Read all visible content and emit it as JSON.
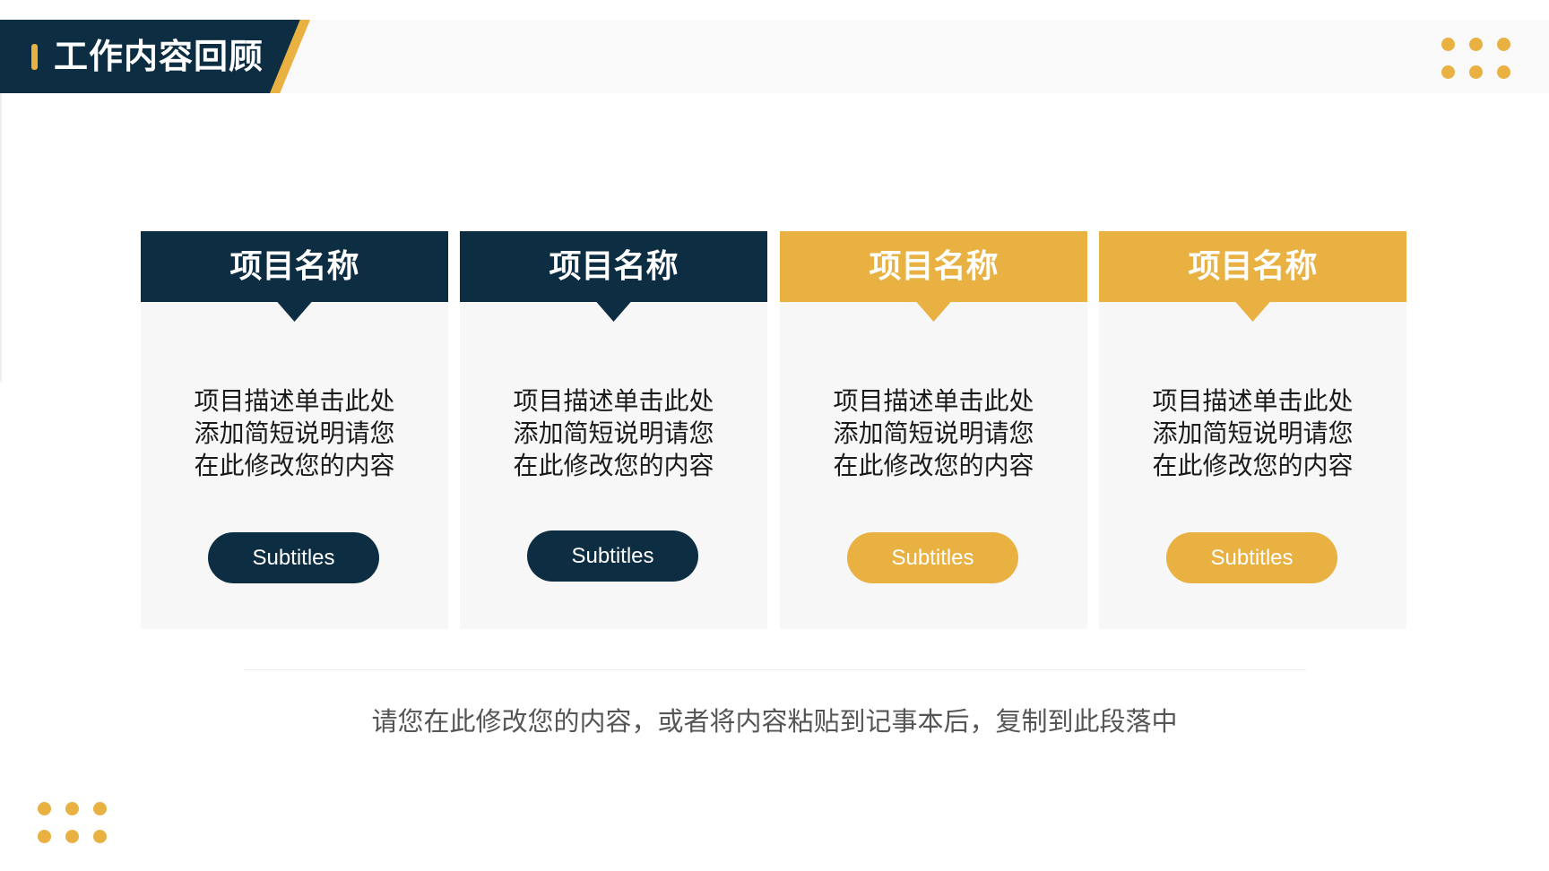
{
  "title": "工作内容回顾",
  "colors": {
    "navy": "#0d2e42",
    "gold": "#e8b142",
    "card_bg": "#f7f7f7"
  },
  "cards": [
    {
      "title": "项目名称",
      "color": "navy",
      "description": [
        "项目描述单击此处",
        "添加简短说明请您",
        "在此修改您的内容"
      ],
      "button": "Subtitles"
    },
    {
      "title": "项目名称",
      "color": "navy",
      "description": [
        "项目描述单击此处",
        "添加简短说明请您",
        "在此修改您的内容"
      ],
      "button": "Subtitles"
    },
    {
      "title": "项目名称",
      "color": "gold",
      "description": [
        "项目描述单击此处",
        "添加简短说明请您",
        "在此修改您的内容"
      ],
      "button": "Subtitles"
    },
    {
      "title": "项目名称",
      "color": "gold",
      "description": [
        "项目描述单击此处",
        "添加简短说明请您",
        "在此修改您的内容"
      ],
      "button": "Subtitles"
    }
  ],
  "footer": "请您在此修改您的内容，或者将内容粘贴到记事本后，复制到此段落中",
  "decorations": {
    "dot_icon": "dot-grid-icon"
  }
}
